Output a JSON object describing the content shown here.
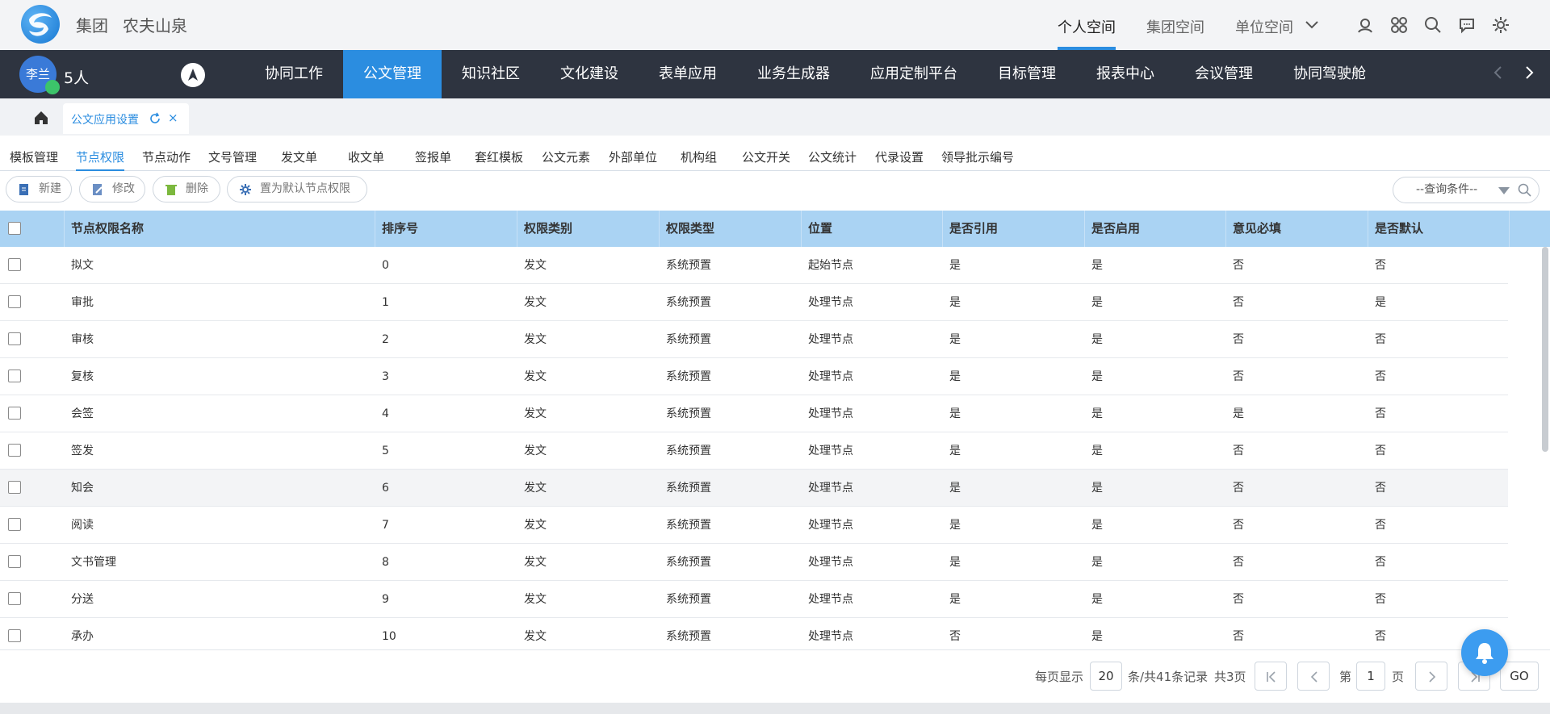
{
  "brand": {
    "group_label": "集团",
    "company": "农夫山泉"
  },
  "spaces": [
    {
      "label": "个人空间",
      "active": true
    },
    {
      "label": "集团空间",
      "active": false
    },
    {
      "label": "单位空间",
      "active": false
    }
  ],
  "user": {
    "avatar_text": "李兰",
    "online_count": "5人"
  },
  "menu": [
    "协同工作",
    "公文管理",
    "知识社区",
    "文化建设",
    "表单应用",
    "业务生成器",
    "应用定制平台",
    "目标管理",
    "报表中心",
    "会议管理",
    "协同驾驶舱"
  ],
  "menu_active_index": 1,
  "doc_tab": {
    "label": "公文应用设置",
    "close": "×"
  },
  "subtabs": [
    "模板管理",
    "节点权限",
    "节点动作",
    "文号管理",
    "发文单",
    "收文单",
    "签报单",
    "套红模板",
    "公文元素",
    "外部单位",
    "机构组",
    "公文开关",
    "公文统计",
    "代录设置",
    "领导批示编号"
  ],
  "subtab_active_index": 1,
  "toolbar": {
    "new": "新建",
    "edit": "修改",
    "delete": "删除",
    "set_default": "置为默认节点权限"
  },
  "query": {
    "placeholder": "--查询条件--"
  },
  "table": {
    "columns": [
      "节点权限名称",
      "排序号",
      "权限类别",
      "权限类型",
      "位置",
      "是否引用",
      "是否启用",
      "意见必填",
      "是否默认"
    ],
    "rows": [
      [
        "拟文",
        "0",
        "发文",
        "系统预置",
        "起始节点",
        "是",
        "是",
        "否",
        "否"
      ],
      [
        "审批",
        "1",
        "发文",
        "系统预置",
        "处理节点",
        "是",
        "是",
        "否",
        "是"
      ],
      [
        "审核",
        "2",
        "发文",
        "系统预置",
        "处理节点",
        "是",
        "是",
        "否",
        "否"
      ],
      [
        "复核",
        "3",
        "发文",
        "系统预置",
        "处理节点",
        "是",
        "是",
        "否",
        "否"
      ],
      [
        "会签",
        "4",
        "发文",
        "系统预置",
        "处理节点",
        "是",
        "是",
        "是",
        "否"
      ],
      [
        "签发",
        "5",
        "发文",
        "系统预置",
        "处理节点",
        "是",
        "是",
        "否",
        "否"
      ],
      [
        "知会",
        "6",
        "发文",
        "系统预置",
        "处理节点",
        "是",
        "是",
        "否",
        "否"
      ],
      [
        "阅读",
        "7",
        "发文",
        "系统预置",
        "处理节点",
        "是",
        "是",
        "否",
        "否"
      ],
      [
        "文书管理",
        "8",
        "发文",
        "系统预置",
        "处理节点",
        "是",
        "是",
        "否",
        "否"
      ],
      [
        "分送",
        "9",
        "发文",
        "系统预置",
        "处理节点",
        "是",
        "是",
        "否",
        "否"
      ],
      [
        "承办",
        "10",
        "发文",
        "系统预置",
        "处理节点",
        "否",
        "是",
        "否",
        "否"
      ]
    ],
    "highlighted_row": 6
  },
  "pager": {
    "per_page_label": "每页显示",
    "per_page": "20",
    "total_label": "条/共41条记录",
    "pages_label": "共3页",
    "page_prefix": "第",
    "page": "1",
    "page_suffix": "页",
    "go": "GO"
  },
  "colors": {
    "accent": "#2b8de0",
    "navbar": "#2e3440",
    "table_header": "#aad3f3"
  }
}
